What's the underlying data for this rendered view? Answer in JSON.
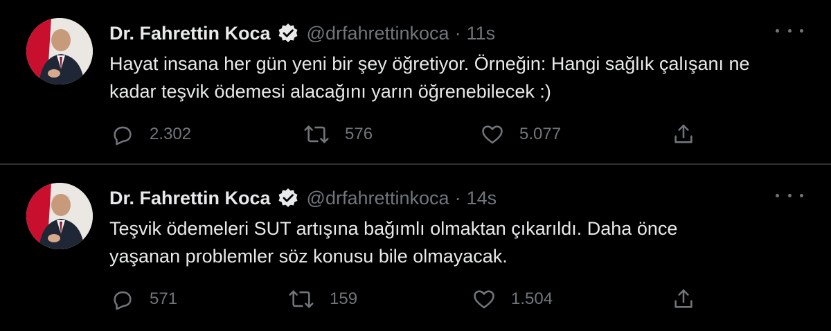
{
  "colors": {
    "background": "#000000",
    "text": "#e7e9ea",
    "secondary": "#71767b",
    "divider": "#2f3336",
    "badge": "#e7e9ea"
  },
  "tweets": [
    {
      "name": "Dr. Fahrettin Koca",
      "handle": "@drfahrettinkoca",
      "separator": "·",
      "time": "11s",
      "text_lines": [
        "Hayat insana her gün yeni bir şey öğretiyor. Örneğin: Hangi sağlık çalışanı ne",
        "kadar teşvik ödemesi alacağını yarın öğrenebilecek :)"
      ],
      "replies": "2.302",
      "retweets": "576",
      "likes": "5.077",
      "icons": {
        "reply": "reply-icon",
        "retweet": "retweet-icon",
        "like": "heart-icon",
        "share": "share-icon",
        "more": "more-dots-icon",
        "verified": "verified-badge-icon"
      }
    },
    {
      "name": "Dr. Fahrettin Koca",
      "handle": "@drfahrettinkoca",
      "separator": "·",
      "time": "14s",
      "text_lines": [
        "Teşvik ödemeleri SUT artışına bağımlı olmaktan çıkarıldı. Daha önce",
        "yaşanan problemler söz konusu bile olmayacak."
      ],
      "replies": "571",
      "retweets": "159",
      "likes": "1.504",
      "icons": {
        "reply": "reply-icon",
        "retweet": "retweet-icon",
        "like": "heart-icon",
        "share": "share-icon",
        "more": "more-dots-icon",
        "verified": "verified-badge-icon"
      }
    }
  ]
}
